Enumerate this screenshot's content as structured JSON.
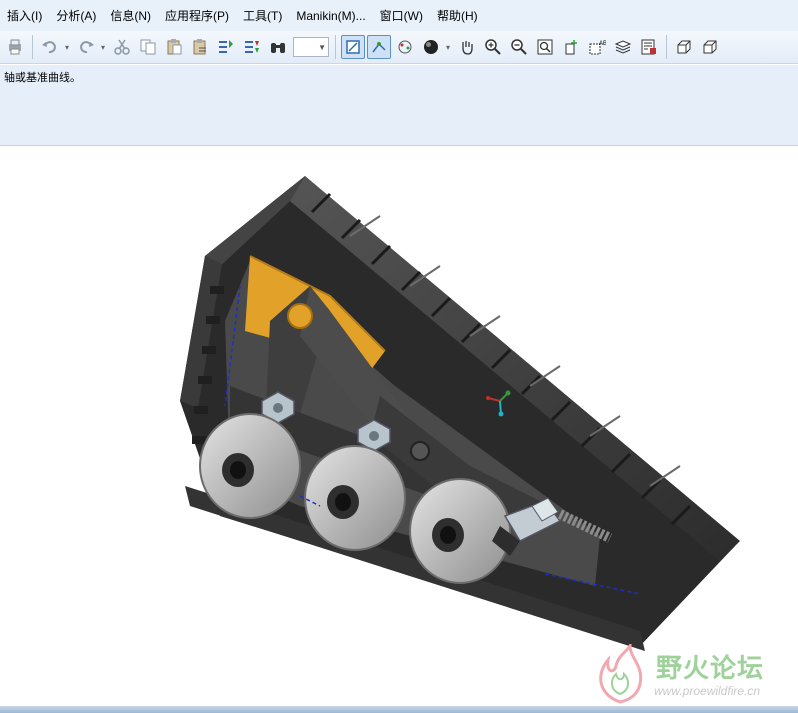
{
  "menubar": {
    "items": [
      {
        "label": "插入(I)"
      },
      {
        "label": "分析(A)"
      },
      {
        "label": "信息(N)"
      },
      {
        "label": "应用程序(P)"
      },
      {
        "label": "工具(T)"
      },
      {
        "label": "Manikin(M)..."
      },
      {
        "label": "窗口(W)"
      },
      {
        "label": "帮助(H)"
      }
    ]
  },
  "message": {
    "text": "轴或基准曲线。"
  },
  "watermark": {
    "title": "野火论坛",
    "url": "www.proewildfire.cn"
  },
  "colors": {
    "menubar_bg": "#e8f0fa",
    "message_bg": "#e6eff9",
    "active_toggle": "#cfe1f5",
    "track": "#3a3a3a",
    "sprocket": "#e2a22a",
    "wheel": "#bdbdbd"
  }
}
